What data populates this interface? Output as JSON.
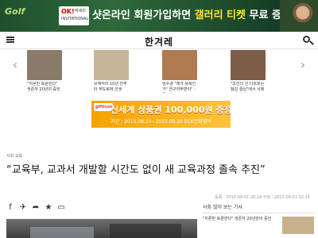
{
  "top_ad": {
    "brand": "Golf",
    "ok_logo": "OK!",
    "ok_sub": "INVITATIONAL",
    "ok_name": "박세리",
    "headline_a": "샷온라인 회원가입하면 ",
    "headline_b": "갤러리 티켓",
    "headline_c": " 무료 증정"
  },
  "header": {
    "logo": "한겨레"
  },
  "news_strip": {
    "items": [
      {
        "caption": "\"지론만 토론한다\" 생존자 20년의 증언 \"잊지지 않았다\"",
        "color": "#8a7a6a"
      },
      {
        "caption": "유재석의 10년 전부터 무도로에 선생님...",
        "color": "#c7b59a"
      },
      {
        "caption": "임수경 \"제가 용북인가\" 연구하부면이\" - 국감",
        "color": "#b07a52"
      },
      {
        "caption": "\"조선의 건 다르르는 참감 결심\"에서 사제고발한다",
        "color": "#7b5d48"
      }
    ]
  },
  "mid_ad": {
    "badge": "gifticon",
    "main": "신세계 상품권 100,000원 증정!",
    "sub": "기간 : 2015.08.24~2015.09.30 ECK전화영어"
  },
  "article": {
    "section": "사회 교육",
    "title": "“교육부, 교과서 개발할 시간도 없이 새 교육과정 졸속 추진”",
    "dates": "등록 : 2015-09-01 20:24  수정 : 2015-09-01 22:15"
  },
  "aside": {
    "heading": "사회 많이 보는 기사",
    "items": [
      {
        "text": "\"지론만 토론한다\" 생존자 20년만의 증언"
      }
    ]
  }
}
